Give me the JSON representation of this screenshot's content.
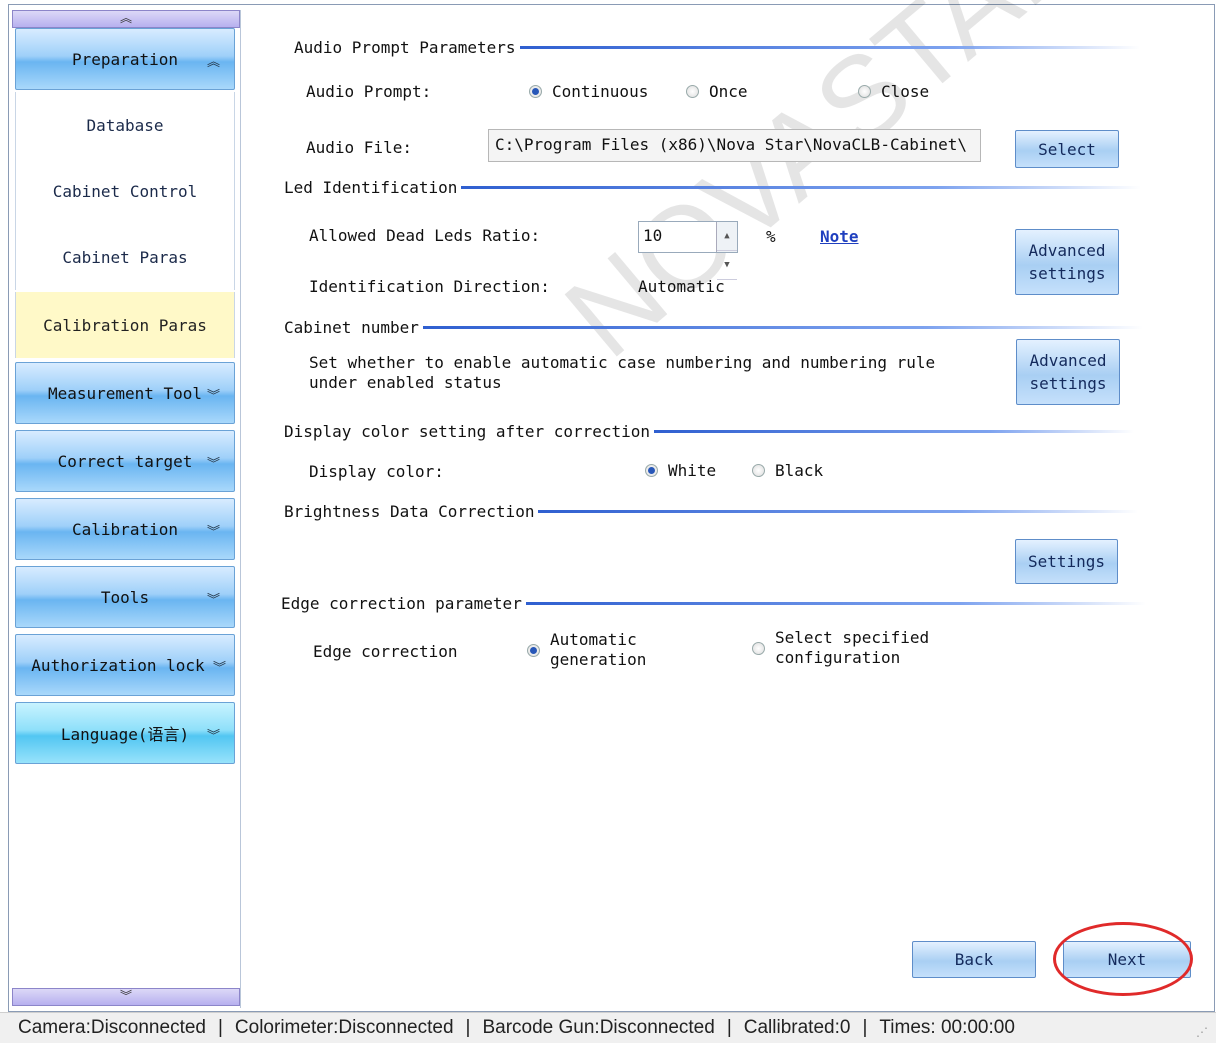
{
  "sidebar": {
    "preparation": "Preparation",
    "sub_items": [
      "Database",
      "Cabinet Control",
      "Cabinet Paras",
      "Calibration Paras"
    ],
    "nav": [
      "Measurement Tool",
      "Correct target",
      "Calibration",
      "Tools",
      "Authorization lock",
      "Language(语言)"
    ]
  },
  "audio": {
    "title": "Audio Prompt Parameters",
    "prompt_label": "Audio Prompt:",
    "opt_continuous": "Continuous",
    "opt_once": "Once",
    "opt_close": "Close",
    "file_label": "Audio File:",
    "file_value": "C:\\Program Files (x86)\\Nova Star\\NovaCLB-Cabinet\\",
    "select_btn": "Select"
  },
  "led": {
    "title": "Led Identification",
    "ratio_label": "Allowed Dead Leds Ratio:",
    "ratio_value": "10",
    "percent": "%",
    "note": "Note",
    "direction_label": "Identification Direction:",
    "direction_value": "Automatic",
    "advanced_btn": "Advanced settings"
  },
  "cabinet": {
    "title": "Cabinet number",
    "description": "Set whether to enable automatic case  numbering and numbering rule under enabled status",
    "advanced_btn": "Advanced settings"
  },
  "display": {
    "title": "Display color setting after correction",
    "label": "Display color:",
    "opt_white": "White",
    "opt_black": "Black"
  },
  "brightness": {
    "title": "Brightness Data Correction",
    "settings_btn": "Settings"
  },
  "edge": {
    "title": "Edge correction parameter",
    "label": "Edge correction",
    "opt_auto": "Automatic generation",
    "opt_specified": "Select specified configuration"
  },
  "footer": {
    "back": "Back",
    "next": "Next"
  },
  "status": {
    "camera": "Camera:Disconnected",
    "colorimeter": "Colorimeter:Disconnected",
    "barcode": "Barcode Gun:Disconnected",
    "calibrated": "Callibrated:0",
    "times": "Times: 00:00:00"
  },
  "watermark": "NOVASTAR TECH CO., LTD"
}
